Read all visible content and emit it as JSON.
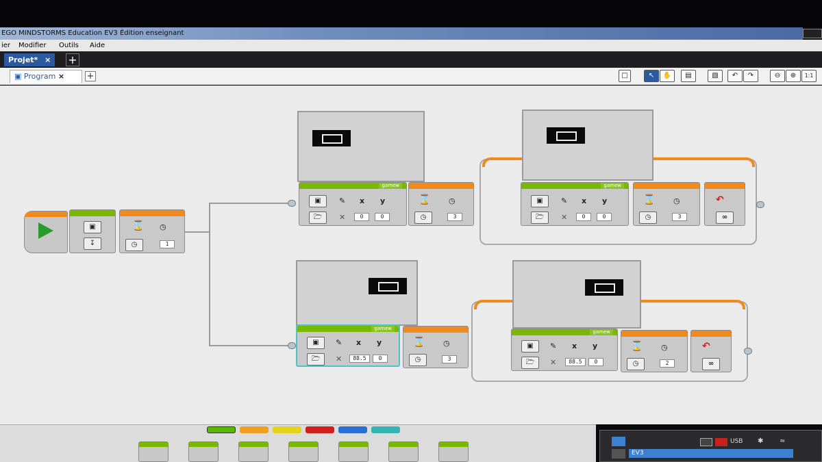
{
  "window": {
    "title": "EGO MINDSTORMS Education EV3 Édition enseignant"
  },
  "menu": [
    "ier",
    "Modifier",
    "Outils",
    "Aide"
  ],
  "project_tab": {
    "label": "Projet*",
    "close": "×",
    "add": "+"
  },
  "program_tab": {
    "label": "Program",
    "close": "×",
    "add": "+"
  },
  "toolbar": {
    "zoom_label": "1:1"
  },
  "top_row": {
    "display_a": {
      "filename": "gamew",
      "x": "0",
      "y": "0"
    },
    "wait_a": {
      "seconds": "3"
    },
    "display_b": {
      "filename": "gamew",
      "x": "0",
      "y": "0"
    },
    "wait_b": {
      "seconds": "3"
    },
    "loop_mode": "∞"
  },
  "start_row": {
    "wait_seconds": "1"
  },
  "bottom_row": {
    "display_a": {
      "filename": "gamew",
      "x": "88.5",
      "y": "0"
    },
    "wait_a": {
      "seconds": "3"
    },
    "display_b": {
      "filename": "gamew",
      "x": "88.5",
      "y": "0"
    },
    "wait_b": {
      "seconds": "2"
    },
    "loop_mode": "∞"
  },
  "palette_colors": [
    "#57b800",
    "#f0a020",
    "#e6d21a",
    "#d21e1e",
    "#2b6fd6",
    "#36b3b3"
  ],
  "hardware": {
    "connection": "USB",
    "brick": "EV3"
  }
}
